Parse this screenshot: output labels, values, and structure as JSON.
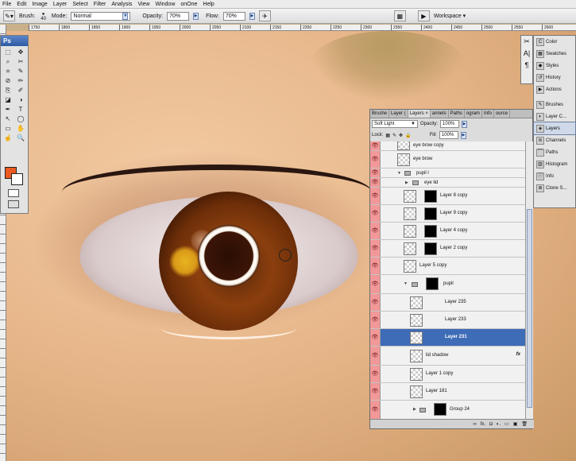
{
  "menu": [
    "File",
    "Edit",
    "Image",
    "Layer",
    "Select",
    "Filter",
    "Analysis",
    "View",
    "Window",
    "onOne",
    "Help"
  ],
  "options": {
    "brush_label": "Brush:",
    "brush_size": "40",
    "mode_label": "Mode:",
    "mode_value": "Normal",
    "opacity_label": "Opacity:",
    "opacity_value": "70%",
    "flow_label": "Flow:",
    "flow_value": "70%",
    "workspace_label": "Workspace"
  },
  "ruler_top": [
    "1750",
    "1800",
    "1850",
    "1900",
    "1950",
    "2000",
    "2050",
    "2100",
    "2150",
    "2200",
    "2250",
    "2300",
    "2350",
    "2400",
    "2450",
    "2500",
    "2550",
    "2600"
  ],
  "toolbox": {
    "title": "Ps",
    "tools": [
      "⬚",
      "✥",
      "⌕",
      "✂",
      "⌗",
      "✎",
      "⊘",
      "✏",
      "⎘",
      "✐",
      "◪",
      "◑",
      "✒",
      "T",
      "↖",
      "◯",
      "▭",
      "✋",
      "☝",
      "🔍"
    ]
  },
  "dock_top": [
    {
      "icon": "C",
      "label": "Color"
    },
    {
      "icon": "▦",
      "label": "Swatches"
    },
    {
      "icon": "◆",
      "label": "Styles"
    },
    {
      "icon": "↺",
      "label": "History"
    },
    {
      "icon": "▶",
      "label": "Actions"
    }
  ],
  "dock_bottom": [
    {
      "icon": "✎",
      "label": "Brushes"
    },
    {
      "icon": "◐",
      "label": "Layer C..."
    },
    {
      "icon": "◈",
      "label": "Layers"
    },
    {
      "icon": "≋",
      "label": "Channels"
    },
    {
      "icon": "⌒",
      "label": "Paths"
    },
    {
      "icon": "▥",
      "label": "Histogram"
    },
    {
      "icon": "ⓘ",
      "label": "Info"
    },
    {
      "icon": "⊕",
      "label": "Clone S..."
    }
  ],
  "layers_panel": {
    "tabs": [
      "Brushe",
      "Layer (",
      "Layers ×",
      "annels",
      "Paths",
      "ogram",
      "Info",
      "ource"
    ],
    "blend_mode": "Soft Light",
    "opacity_label": "Opacity:",
    "opacity_value": "100%",
    "lock_label": "Lock:",
    "fill_label": "Fill:",
    "fill_value": "100%",
    "layers": [
      {
        "name": "eye brow copy"
      },
      {
        "name": "eye brow"
      },
      {
        "name": "pupil l"
      },
      {
        "name": "eye lid"
      },
      {
        "name": "Layer 8 copy"
      },
      {
        "name": "Layer 9 copy"
      },
      {
        "name": "Layer 4 copy"
      },
      {
        "name": "Layer 2 copy"
      },
      {
        "name": "Layer 5 copy"
      },
      {
        "name": "pupil"
      },
      {
        "name": "Layer 235"
      },
      {
        "name": "Layer 233"
      },
      {
        "name": "Layer 231"
      },
      {
        "name": "lid shadow",
        "fx": "fx"
      },
      {
        "name": "Layer 1 copy"
      },
      {
        "name": "Layer 181"
      },
      {
        "name": "Group 24"
      }
    ],
    "bottom_icons": [
      "∞",
      "fx.",
      "◘",
      "◐.",
      "▭",
      "▣",
      "🗑"
    ]
  },
  "colors": {
    "foreground": "#ea5a21",
    "background": "#ffffff",
    "selected_layer": "#3e6cb7",
    "visibility_column": "#f29898"
  }
}
